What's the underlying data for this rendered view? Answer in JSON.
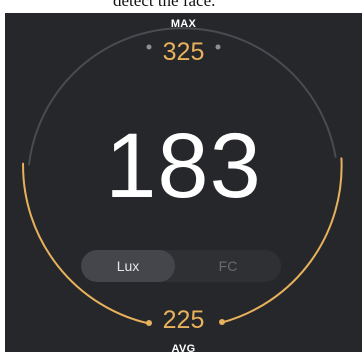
{
  "caption": {
    "text": "detect the face."
  },
  "meter": {
    "max_label": "MAX",
    "max_value": "325",
    "current_reading": "183",
    "avg_value": "225",
    "avg_label": "AVG"
  },
  "units": {
    "options": [
      "Lux",
      "FC"
    ],
    "selected": "Lux"
  },
  "colors": {
    "background": "#26272a",
    "accent": "#e8b15b",
    "track": "#4a4b50",
    "text": "#ffffff"
  },
  "gauge": {
    "level_fraction_of_max": 0.56
  }
}
